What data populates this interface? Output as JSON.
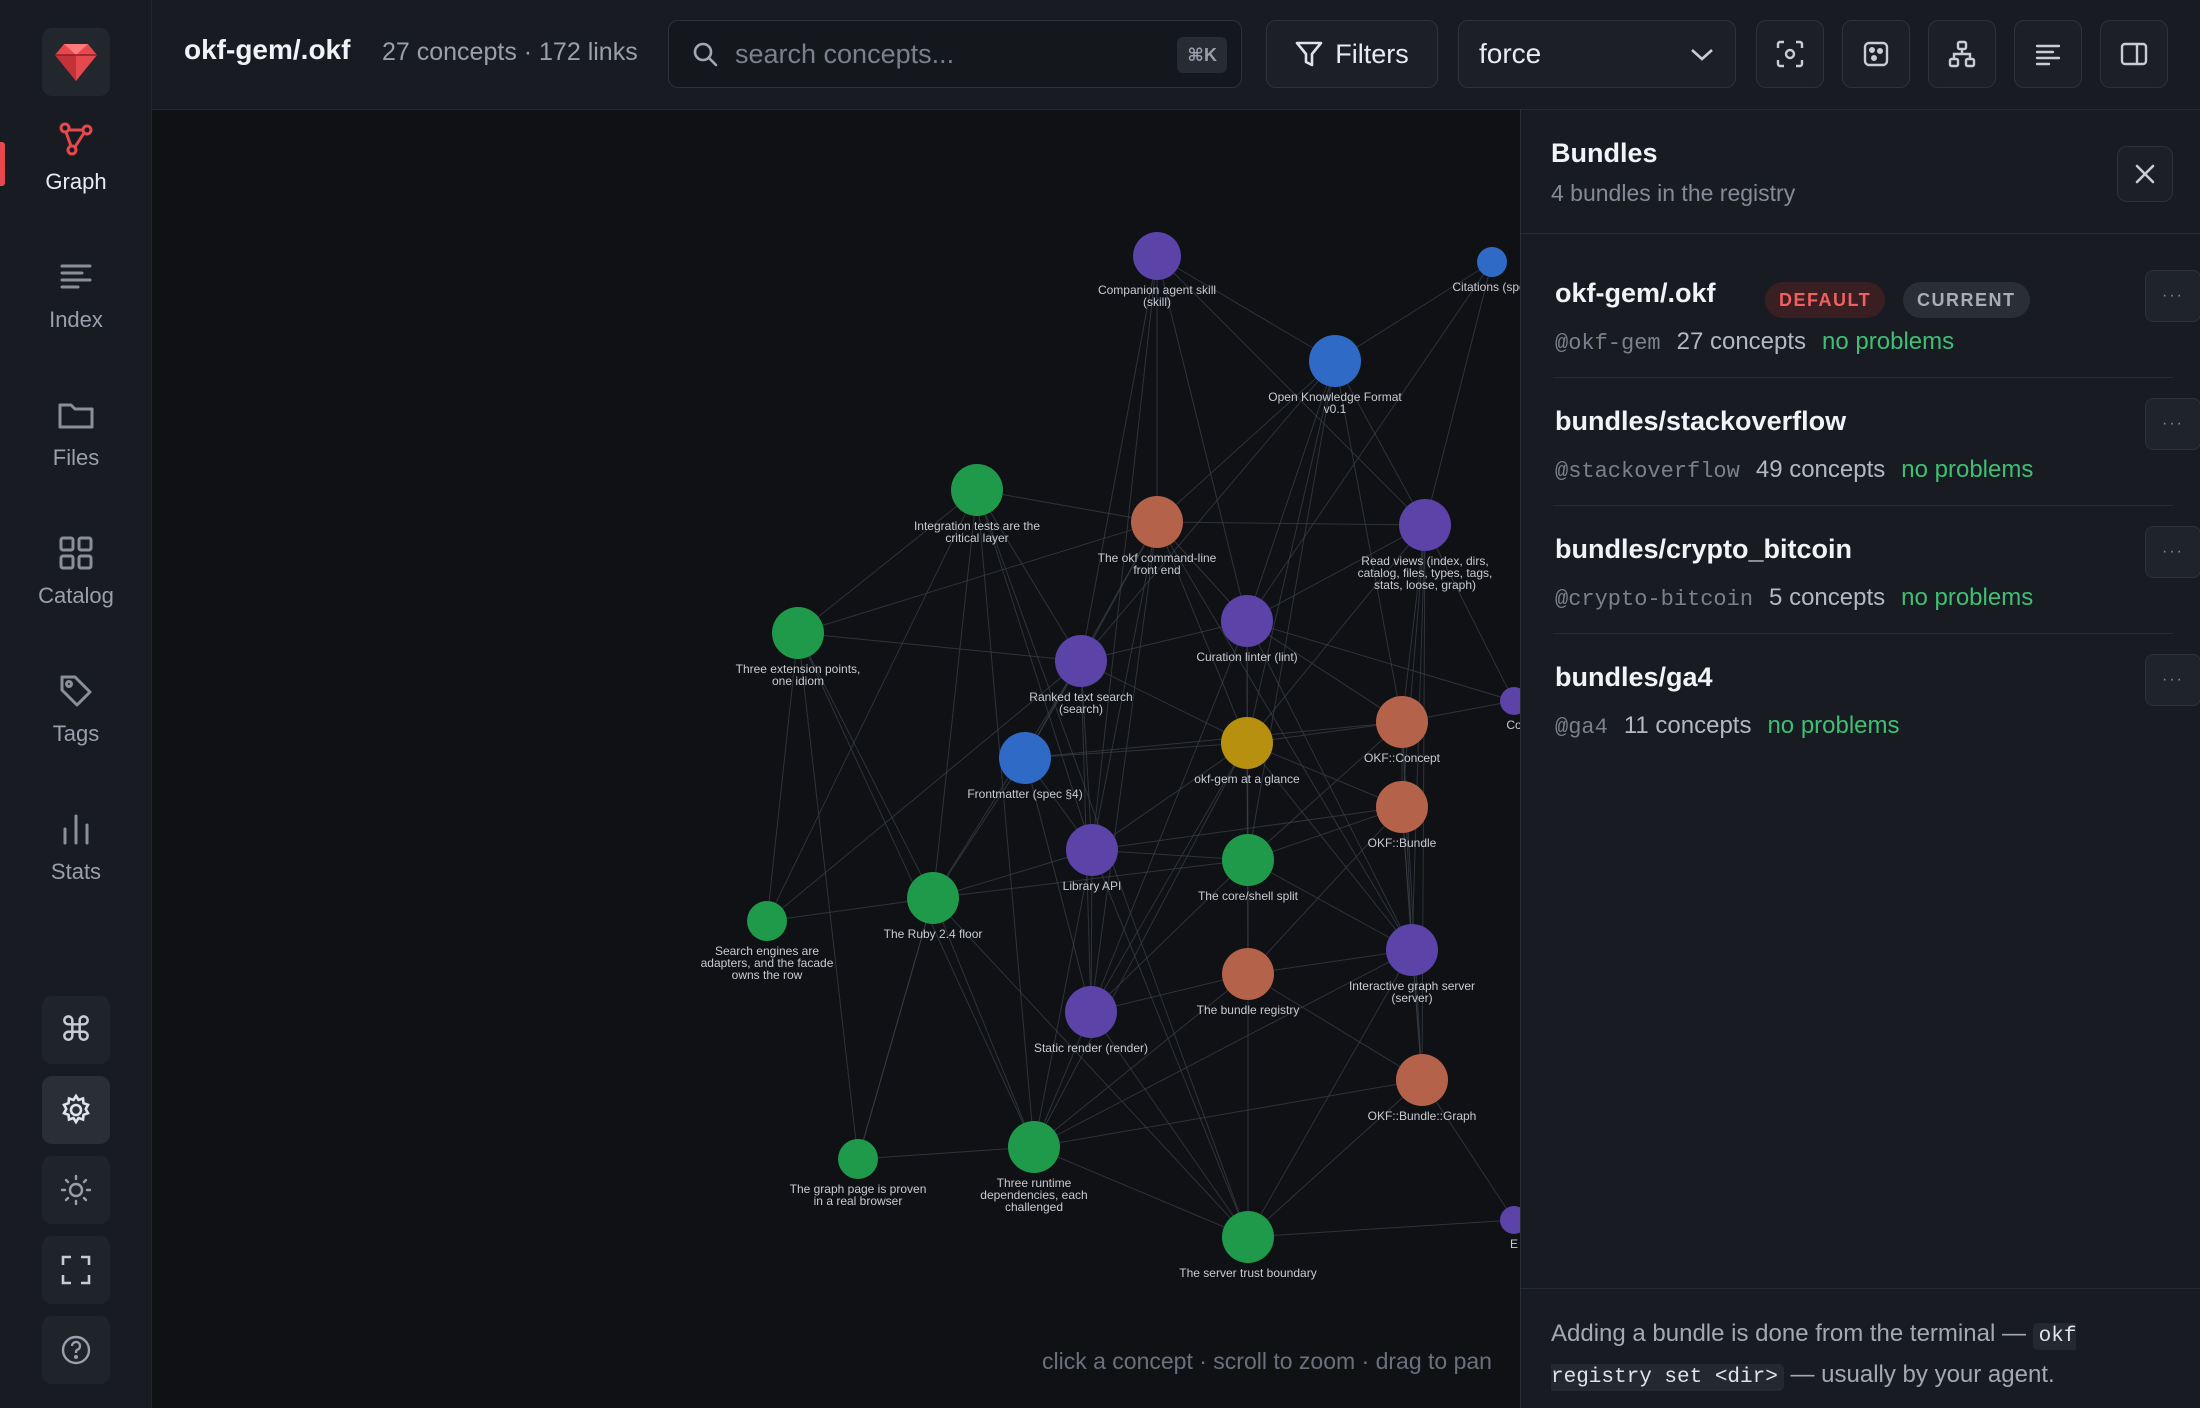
{
  "app": {
    "bundle_title": "okf-gem/.okf",
    "summary": "27 concepts · 172 links"
  },
  "nav": {
    "items": [
      {
        "label": "Graph",
        "icon": "graph-icon"
      },
      {
        "label": "Index",
        "icon": "index-icon"
      },
      {
        "label": "Files",
        "icon": "folder-icon"
      },
      {
        "label": "Catalog",
        "icon": "catalog-icon"
      },
      {
        "label": "Tags",
        "icon": "tag-icon"
      },
      {
        "label": "Stats",
        "icon": "stats-icon"
      }
    ],
    "active": "Graph"
  },
  "search": {
    "placeholder": "search concepts...",
    "shortcut": "⌘K"
  },
  "toolbar": {
    "filters_label": "Filters",
    "layout_value": "force"
  },
  "colors": {
    "accent": "#e5484d",
    "success": "#3fbf74",
    "purple": "#5b43a8",
    "blue": "#2f6bc6",
    "green": "#1f9a4a",
    "orange": "#b5624a",
    "gold": "#b8900f"
  },
  "graph": {
    "hint": "click a concept · scroll to zoom · drag to pan",
    "nodes": [
      {
        "id": "n1",
        "label": [
          "Companion agent skill",
          "(skill)"
        ],
        "color": "purple"
      },
      {
        "id": "n2",
        "label": [
          "Citations (spec"
        ],
        "color": "blue"
      },
      {
        "id": "n3",
        "label": [
          "Open Knowledge Format",
          "v0.1"
        ],
        "color": "blue"
      },
      {
        "id": "n4",
        "label": [
          "Integration tests are the",
          "critical layer"
        ],
        "color": "green"
      },
      {
        "id": "n5",
        "label": [
          "The okf command-line",
          "front end"
        ],
        "color": "orange"
      },
      {
        "id": "n6",
        "label": [
          "Read views (index, dirs,",
          "catalog, files, types, tags,",
          "stats, loose, graph)"
        ],
        "color": "purple"
      },
      {
        "id": "n7",
        "label": [
          "Three extension points,",
          "one idiom"
        ],
        "color": "green"
      },
      {
        "id": "n8",
        "label": [
          "Ranked text search",
          "(search)"
        ],
        "color": "purple"
      },
      {
        "id": "n9",
        "label": [
          "Curation linter (lint)"
        ],
        "color": "purple"
      },
      {
        "id": "n10",
        "label": [
          "Frontmatter (spec §4)"
        ],
        "color": "blue"
      },
      {
        "id": "n11",
        "label": [
          "okf-gem at a glance"
        ],
        "color": "gold"
      },
      {
        "id": "n12",
        "label": [
          "OKF::Concept"
        ],
        "color": "orange"
      },
      {
        "id": "n13",
        "label": [
          "OKF::Bundle"
        ],
        "color": "orange"
      },
      {
        "id": "n14",
        "label": [
          "Library API"
        ],
        "color": "purple"
      },
      {
        "id": "n15",
        "label": [
          "The core/shell split"
        ],
        "color": "green"
      },
      {
        "id": "n16",
        "label": [
          "The Ruby 2.4 floor"
        ],
        "color": "green"
      },
      {
        "id": "n17",
        "label": [
          "Search engines are",
          "adapters, and the facade",
          "owns the row"
        ],
        "color": "green"
      },
      {
        "id": "n18",
        "label": [
          "Interactive graph server",
          "(server)"
        ],
        "color": "purple"
      },
      {
        "id": "n19",
        "label": [
          "The bundle registry"
        ],
        "color": "orange"
      },
      {
        "id": "n20",
        "label": [
          "Static render (render)"
        ],
        "color": "purple"
      },
      {
        "id": "n21",
        "label": [
          "OKF::Bundle::Graph"
        ],
        "color": "orange"
      },
      {
        "id": "n22",
        "label": [
          "Three runtime",
          "dependencies, each",
          "challenged"
        ],
        "color": "green"
      },
      {
        "id": "n23",
        "label": [
          "The graph page is proven",
          "in a real browser"
        ],
        "color": "green"
      },
      {
        "id": "n24",
        "label": [
          "The server trust boundary"
        ],
        "color": "green"
      },
      {
        "id": "n25",
        "label": [
          "Co"
        ],
        "color": "purple"
      },
      {
        "id": "n26",
        "label": [
          "E"
        ],
        "color": "purple"
      }
    ]
  },
  "panel": {
    "title": "Bundles",
    "subtitle": "4 bundles in the registry",
    "bundles": [
      {
        "name": "okf-gem/.okf",
        "handle": "@okf-gem",
        "concepts": "27 concepts",
        "status": "no problems",
        "badges": [
          "DEFAULT",
          "CURRENT"
        ]
      },
      {
        "name": "bundles/stackoverflow",
        "handle": "@stackoverflow",
        "concepts": "49 concepts",
        "status": "no problems",
        "badges": []
      },
      {
        "name": "bundles/crypto_bitcoin",
        "handle": "@crypto-bitcoin",
        "concepts": "5 concepts",
        "status": "no problems",
        "badges": []
      },
      {
        "name": "bundles/ga4",
        "handle": "@ga4",
        "concepts": "11 concepts",
        "status": "no problems",
        "badges": []
      }
    ],
    "more_label": "···",
    "footer_text_1": "Adding a bundle is done from the terminal —",
    "footer_code": "okf registry set <dir>",
    "footer_text_2": "— usually by your agent."
  }
}
